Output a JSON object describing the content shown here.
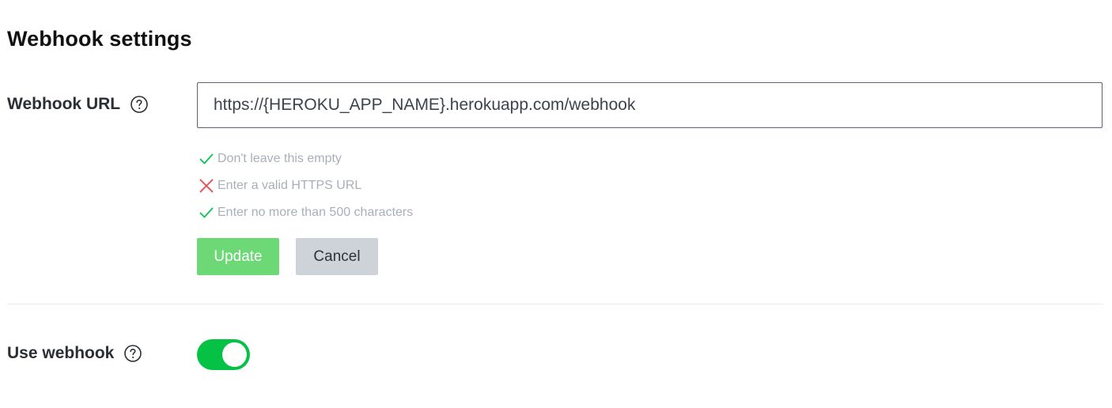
{
  "section": {
    "title": "Webhook settings"
  },
  "webhook_url": {
    "label": "Webhook URL",
    "help_icon": "question-circle-icon",
    "value": "https://{HEROKU_APP_NAME}.herokuapp.com/webhook"
  },
  "validation": {
    "rules": [
      {
        "status": "pass",
        "icon": "check-icon",
        "text": "Don't leave this empty"
      },
      {
        "status": "fail",
        "icon": "cross-icon",
        "text": "Enter a valid HTTPS URL"
      },
      {
        "status": "pass",
        "icon": "check-icon",
        "text": "Enter no more than 500 characters"
      }
    ]
  },
  "actions": {
    "update_label": "Update",
    "cancel_label": "Cancel"
  },
  "use_webhook": {
    "label": "Use webhook",
    "help_icon": "question-circle-icon",
    "enabled": true
  },
  "colors": {
    "pass": "#06c755",
    "fail": "#ef454d",
    "toggle_on": "#06c244",
    "update_button": "#6cd876",
    "cancel_button": "#ced3da",
    "hint_text": "#a9afb8"
  }
}
